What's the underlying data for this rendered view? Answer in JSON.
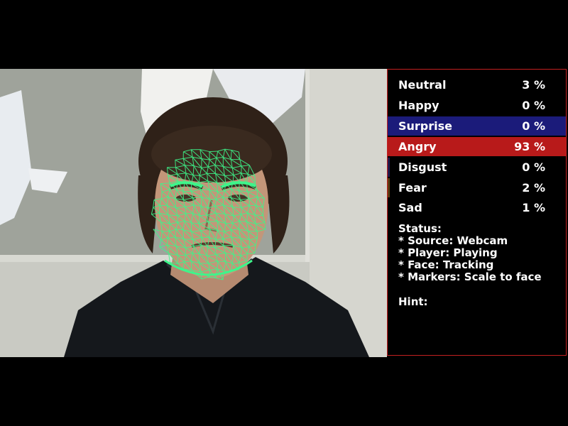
{
  "emotions": [
    {
      "label": "Neutral",
      "value": "3 %",
      "level": 0.03,
      "highlight": "none"
    },
    {
      "label": "Happy",
      "value": "0 %",
      "level": 0.0,
      "highlight": "none"
    },
    {
      "label": "Surprise",
      "value": "0 %",
      "level": 0.0,
      "highlight": "#1b1b7a"
    },
    {
      "label": "Angry",
      "value": "93 %",
      "level": 0.93,
      "highlight": "#b81a1a"
    },
    {
      "label": "Disgust",
      "value": "0 %",
      "level": 0.0,
      "highlight": "#23184a"
    },
    {
      "label": "Fear",
      "value": "2 %",
      "level": 0.02,
      "highlight": "#5a3a10"
    },
    {
      "label": "Sad",
      "value": "1 %",
      "level": 0.01,
      "highlight": "none"
    }
  ],
  "status": {
    "title": "Status:",
    "lines": [
      "* Source: Webcam",
      "* Player: Playing",
      "* Face: Tracking",
      "* Markers: Scale to face"
    ]
  },
  "hint": {
    "label": "Hint:"
  },
  "colors": {
    "panel_border": "#c32020",
    "mesh": "#3ef58a",
    "angry_bar": "#b81a1a",
    "surprise_bar": "#1b1b7a"
  }
}
